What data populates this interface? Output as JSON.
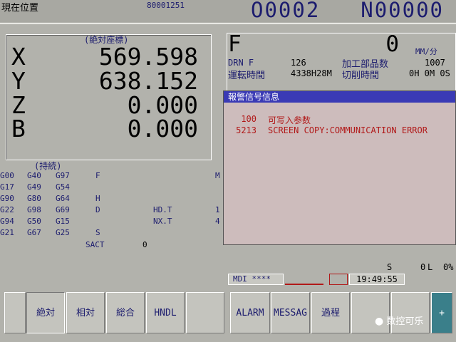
{
  "header": {
    "title": "現在位置",
    "program_id": "80001251",
    "o_number": "O0002",
    "n_number": "N00000"
  },
  "absolute": {
    "heading": "(絶対座標)",
    "axes": [
      {
        "name": "X",
        "value": "569.598"
      },
      {
        "name": "Y",
        "value": "638.152"
      },
      {
        "name": "Z",
        "value": "0.000"
      },
      {
        "name": "B",
        "value": "0.000"
      }
    ]
  },
  "modal": {
    "heading": "(持続)",
    "rows": [
      [
        "G00",
        "G40",
        "G97",
        "F",
        "",
        "M",
        ""
      ],
      [
        "G17",
        "G49",
        "G54",
        "",
        "",
        "",
        ""
      ],
      [
        "G90",
        "G80",
        "G64",
        "H",
        "",
        "",
        ""
      ],
      [
        "G22",
        "G98",
        "G69",
        "D",
        "HD.T",
        "1",
        ""
      ],
      [
        "G94",
        "G50",
        "G15",
        "",
        "NX.T",
        "4",
        ""
      ],
      [
        "G21",
        "G67",
        "G25",
        "S",
        "",
        "",
        ""
      ]
    ],
    "sact_label": "SACT",
    "sact_value": "0"
  },
  "feed": {
    "label": "F",
    "value": "0",
    "unit": "MM/分",
    "drn_label": "DRN F",
    "drn_value": "126",
    "parts_label": "加工部品数",
    "parts_value": "1007",
    "run_label": "運転時間",
    "run_value": "4338H28M",
    "cut_label": "切削時間",
    "cut_value": "0H 0M 0S"
  },
  "alarm": {
    "title": "報警信号信息",
    "items": [
      {
        "code": "100",
        "text": "可写入参数"
      },
      {
        "code": "5213",
        "text": "SCREEN COPY:COMMUNICATION ERROR"
      }
    ]
  },
  "status": {
    "s_label": "S",
    "s_value": "0",
    "l_label": "L",
    "l_value": "0%",
    "mode": "MDI ****",
    "clock": "19:49:55"
  },
  "softkeys": [
    {
      "label": ""
    },
    {
      "label": "絶対"
    },
    {
      "label": "相対"
    },
    {
      "label": "総合"
    },
    {
      "label": "HNDL"
    },
    {
      "label": ""
    },
    {
      "label": "ALARM"
    },
    {
      "label": "MESSAG"
    },
    {
      "label": "過程"
    },
    {
      "label": ""
    },
    {
      "label": ""
    },
    {
      "label": "+"
    }
  ],
  "watermark": "数控可乐"
}
